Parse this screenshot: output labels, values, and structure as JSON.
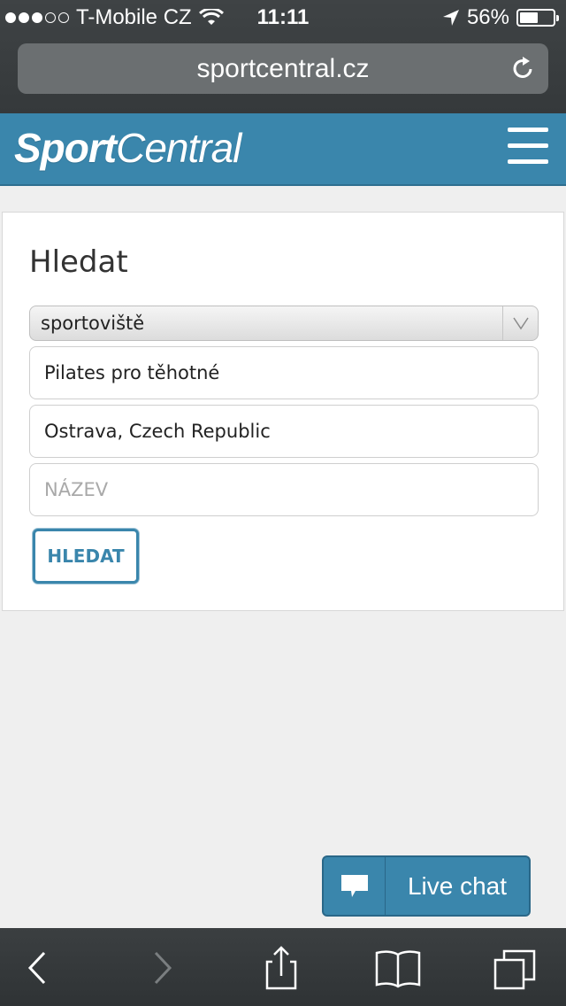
{
  "status_bar": {
    "carrier": "T-Mobile CZ",
    "time": "11:11",
    "battery": "56%",
    "battery_level": 0.56,
    "signal_bars_filled": 3,
    "signal_bars_total": 5
  },
  "browser": {
    "url": "sportcentral.cz"
  },
  "header": {
    "logo_part1": "Sport",
    "logo_part2": "Central",
    "brand_color": "#3a86ac"
  },
  "search": {
    "title": "Hledat",
    "type_select": "sportoviště",
    "activity_value": "Pilates pro těhotné",
    "location_value": "Ostrava, Czech Republic",
    "name_placeholder": "NÁZEV",
    "submit_label": "HLEDAT"
  },
  "chat": {
    "label": "Live chat"
  },
  "toolbar": {
    "icons": [
      "back-icon",
      "forward-icon",
      "share-icon",
      "bookmarks-icon",
      "tabs-icon"
    ]
  }
}
